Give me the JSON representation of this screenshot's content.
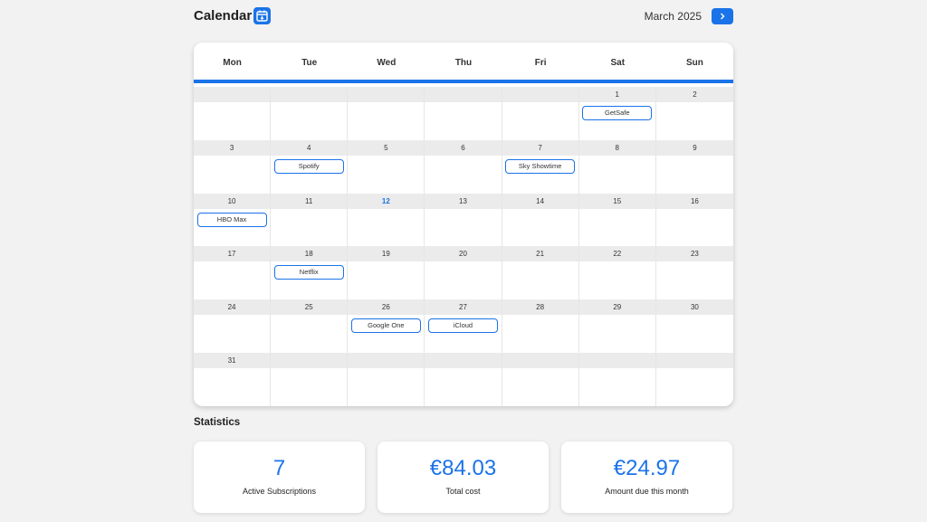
{
  "header": {
    "title": "Calendar",
    "month": "March 2025",
    "icon": "calendar-icon",
    "next_icon": "chevron-right-icon"
  },
  "calendar": {
    "weekdays": [
      "Mon",
      "Tue",
      "Wed",
      "Thu",
      "Fri",
      "Sat",
      "Sun"
    ],
    "today": 12,
    "accent_color": "#1a73e8",
    "weeks": [
      [
        null,
        null,
        null,
        null,
        null,
        {
          "day": 1,
          "events": [
            "GetSafe"
          ]
        },
        {
          "day": 2,
          "events": []
        }
      ],
      [
        {
          "day": 3,
          "events": []
        },
        {
          "day": 4,
          "events": [
            "Spotify"
          ]
        },
        {
          "day": 5,
          "events": []
        },
        {
          "day": 6,
          "events": []
        },
        {
          "day": 7,
          "events": [
            "Sky Showtime"
          ]
        },
        {
          "day": 8,
          "events": []
        },
        {
          "day": 9,
          "events": []
        }
      ],
      [
        {
          "day": 10,
          "events": [
            "HBO Max"
          ]
        },
        {
          "day": 11,
          "events": []
        },
        {
          "day": 12,
          "events": []
        },
        {
          "day": 13,
          "events": []
        },
        {
          "day": 14,
          "events": []
        },
        {
          "day": 15,
          "events": []
        },
        {
          "day": 16,
          "events": []
        }
      ],
      [
        {
          "day": 17,
          "events": []
        },
        {
          "day": 18,
          "events": [
            "Netflix"
          ]
        },
        {
          "day": 19,
          "events": []
        },
        {
          "day": 20,
          "events": []
        },
        {
          "day": 21,
          "events": []
        },
        {
          "day": 22,
          "events": []
        },
        {
          "day": 23,
          "events": []
        }
      ],
      [
        {
          "day": 24,
          "events": []
        },
        {
          "day": 25,
          "events": []
        },
        {
          "day": 26,
          "events": [
            "Google One"
          ]
        },
        {
          "day": 27,
          "events": [
            "iCloud"
          ]
        },
        {
          "day": 28,
          "events": []
        },
        {
          "day": 29,
          "events": []
        },
        {
          "day": 30,
          "events": []
        }
      ],
      [
        {
          "day": 31,
          "events": []
        },
        null,
        null,
        null,
        null,
        null,
        null
      ]
    ]
  },
  "statistics": {
    "title": "Statistics",
    "cards": [
      {
        "value": "7",
        "label": "Active Subscriptions"
      },
      {
        "value": "€84.03",
        "label": "Total cost"
      },
      {
        "value": "€24.97",
        "label": "Amount due this month"
      }
    ]
  }
}
